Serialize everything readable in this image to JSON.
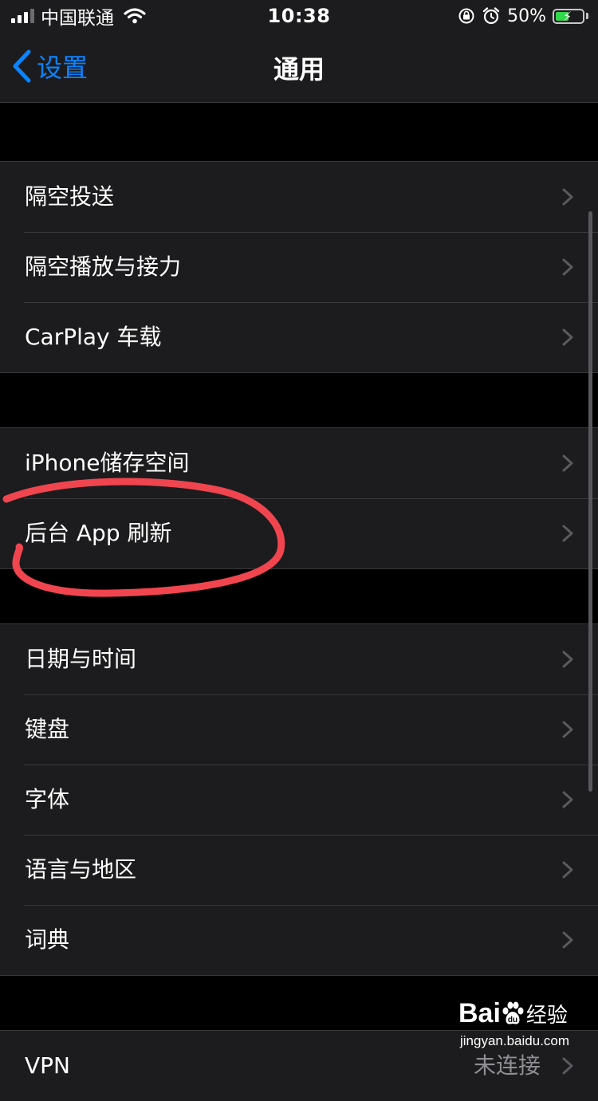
{
  "status_bar": {
    "carrier": "中国联通",
    "time": "10:38",
    "battery_percent": "50%",
    "battery_level": 0.5,
    "signal_bars": 4,
    "signal_bars_filled": 3
  },
  "nav": {
    "back_label": "设置",
    "title": "通用"
  },
  "groups": [
    {
      "items": [
        {
          "label": "隔空投送"
        },
        {
          "label": "隔空播放与接力"
        },
        {
          "label": "CarPlay 车载"
        }
      ]
    },
    {
      "items": [
        {
          "label": "iPhone储存空间"
        },
        {
          "label": "后台 App 刷新"
        }
      ]
    },
    {
      "items": [
        {
          "label": "日期与时间"
        },
        {
          "label": "键盘"
        },
        {
          "label": "字体"
        },
        {
          "label": "语言与地区"
        },
        {
          "label": "词典"
        }
      ]
    },
    {
      "items": [
        {
          "label": "VPN",
          "value": "未连接"
        }
      ]
    }
  ],
  "watermark": {
    "logo_text": "Bai",
    "logo_suffix": "经验",
    "url": "jingyan.baidu.com"
  },
  "colors": {
    "accent": "#0a84ff",
    "annotation": "#f0454f",
    "battery_fill": "#32d74b",
    "cell_background": "#1c1c1e"
  },
  "icons": [
    "signal-icon",
    "wifi-icon",
    "orientation-lock-icon",
    "alarm-icon",
    "battery-icon",
    "back-chevron-icon",
    "chevron-right-icon",
    "baidu-paw-icon"
  ]
}
